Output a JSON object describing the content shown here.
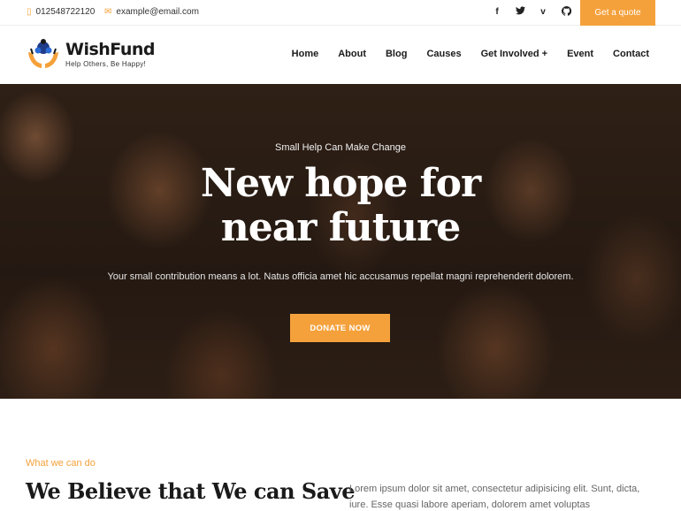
{
  "topbar": {
    "phone": "012548722120",
    "email": "example@email.com",
    "socials": [
      {
        "icon": "facebook-icon",
        "glyph": "f"
      },
      {
        "icon": "twitter-icon",
        "glyph": "𝕥"
      },
      {
        "icon": "vimeo-icon",
        "glyph": "v"
      },
      {
        "icon": "github-icon",
        "glyph": "◉"
      }
    ],
    "quote_label": "Get a quote"
  },
  "header": {
    "brand": "WishFund",
    "tagline": "Help Others, Be Happy!",
    "nav": [
      "Home",
      "About",
      "Blog",
      "Causes",
      "Get Involved +",
      "Event",
      "Contact"
    ]
  },
  "hero": {
    "eyebrow": "Small Help Can Make Change",
    "title": "New hope for near future",
    "description": "Your small contribution means a lot. Natus officia amet hic accusamus repellat magni reprehenderit dolorem.",
    "cta_label": "DONATE NOW"
  },
  "about": {
    "eyebrow": "What we can do",
    "title": "We Believe that We can Save",
    "text": "Lorem ipsum dolor sit amet, consectetur adipisicing elit. Sunt, dicta, iure. Esse quasi labore aperiam, dolorem amet voluptas"
  },
  "colors": {
    "accent": "#f5a13b",
    "dark_text": "#1a1a1a"
  }
}
